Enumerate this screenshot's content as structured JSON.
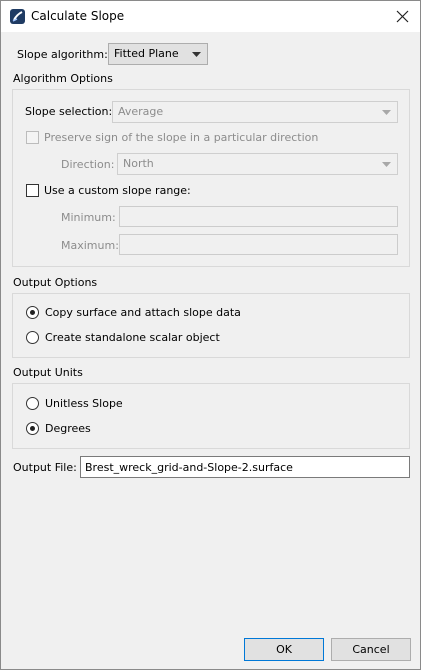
{
  "window": {
    "title": "Calculate Slope",
    "icon": "app-icon",
    "close_icon": "close-icon"
  },
  "slope_algorithm": {
    "label": "Slope algorithm:",
    "value": "Fitted Plane"
  },
  "algorithm_options": {
    "heading": "Algorithm Options",
    "slope_selection_label": "Slope selection:",
    "slope_selection_value": "Average",
    "preserve_sign_label": "Preserve sign of the slope in a particular direction",
    "preserve_sign_checked": false,
    "direction_label": "Direction:",
    "direction_value": "North",
    "custom_range_label": "Use a custom slope range:",
    "custom_range_checked": false,
    "minimum_label": "Minimum:",
    "minimum_value": "",
    "maximum_label": "Maximum:",
    "maximum_value": ""
  },
  "output_options": {
    "heading": "Output Options",
    "copy_surface_label": "Copy surface and attach slope data",
    "copy_surface_selected": true,
    "standalone_label": "Create standalone scalar object",
    "standalone_selected": false
  },
  "output_units": {
    "heading": "Output Units",
    "unitless_label": "Unitless Slope",
    "unitless_selected": false,
    "degrees_label": "Degrees",
    "degrees_selected": true
  },
  "output_file": {
    "label": "Output File:",
    "value": "Brest_wreck_grid-and-Slope-2.surface"
  },
  "buttons": {
    "ok": "OK",
    "cancel": "Cancel"
  },
  "colors": {
    "default_button_border": "#0078d7",
    "disabled_text": "#8c8c8c"
  }
}
